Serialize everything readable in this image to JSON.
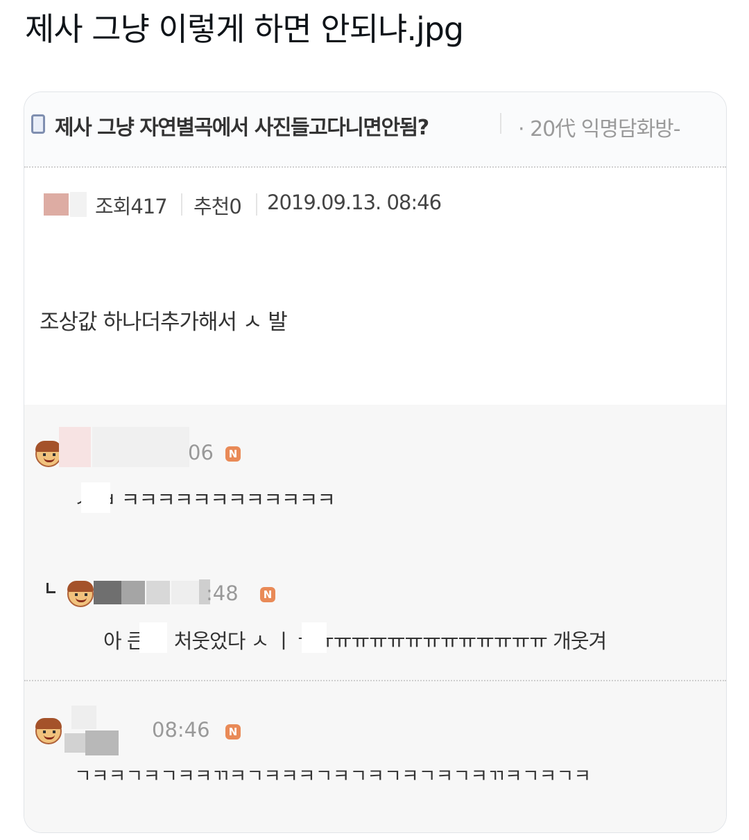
{
  "page_title": "제사 그냥 이렇게 하면 안되냐.jpg",
  "post": {
    "title": "제사 그냥 자연별곡에서 사진들고다니면안됨?",
    "board": "· 20代 익명담화방-",
    "views_label": "조회417",
    "likes_label": "추천0",
    "date": "2019.09.13. 08:46",
    "body": "조상값 하나더추가해서 ㅅ 발"
  },
  "comments": [
    {
      "time": "06",
      "badge": "N",
      "text": "ㅅ ㅂ ㅋㅋㅋㅋㅋㅋㅋㅋㅋㅋㅋㅋ"
    },
    {
      "reply_marker": "ㄴ",
      "time": ":48",
      "badge": "N",
      "text": "아 큰 ㅏ 처웃었다 ㅅ ㅣ ㅠㅠㅠㅠㅠㅠㅠㅠㅠㅠㅠㅠㅠㅠ 개웃겨"
    },
    {
      "time": "08:46",
      "badge": "N",
      "text": "ㄱㅋㅋㄱㅋㄱㅋㅋㄲㅋㄱㅋㅋㅋㄱㅋㄱㅋㄱㅋㄱㅋㄱㅋㄲㅋㄱㅋㄱㅋ"
    }
  ],
  "colors": {
    "badge": "#e98a57",
    "comment_bg": "#f7f7f7",
    "avatar_hair": "#a4522a"
  }
}
